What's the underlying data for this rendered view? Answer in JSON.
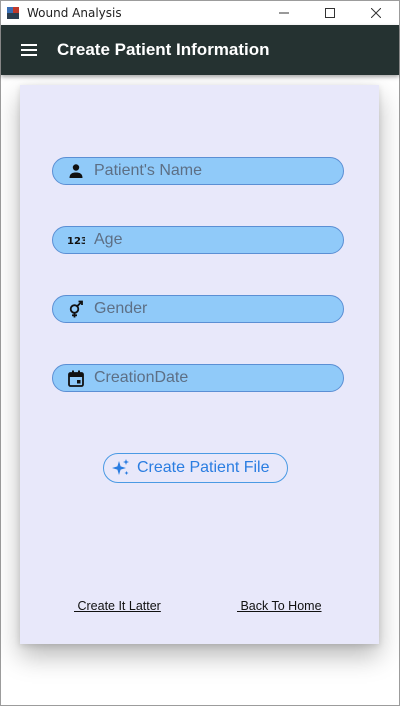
{
  "window": {
    "title": "Wound Analysis",
    "controls": {
      "minimize": "minimize-icon",
      "maximize": "maximize-icon",
      "close": "close-icon"
    }
  },
  "appbar": {
    "menu_icon": "menu-icon",
    "title": "Create Patient Information"
  },
  "form": {
    "name": {
      "icon": "person-icon",
      "placeholder": "Patient's Name",
      "value": ""
    },
    "age": {
      "icon": "numbers-123-icon",
      "placeholder": "Age",
      "value": ""
    },
    "gender": {
      "icon": "gender-icon",
      "placeholder": "Gender",
      "value": ""
    },
    "date": {
      "icon": "calendar-icon",
      "placeholder": "CreationDate",
      "value": ""
    }
  },
  "actions": {
    "create_icon": "sparkle-icon",
    "create_label": "Create Patient File",
    "later_label": " Create It Latter",
    "home_label": " Back To Home"
  },
  "colors": {
    "appbar": "#253231",
    "card": "#e8e8fa",
    "field_fill": "#90caf9",
    "accent": "#2a7de1"
  }
}
